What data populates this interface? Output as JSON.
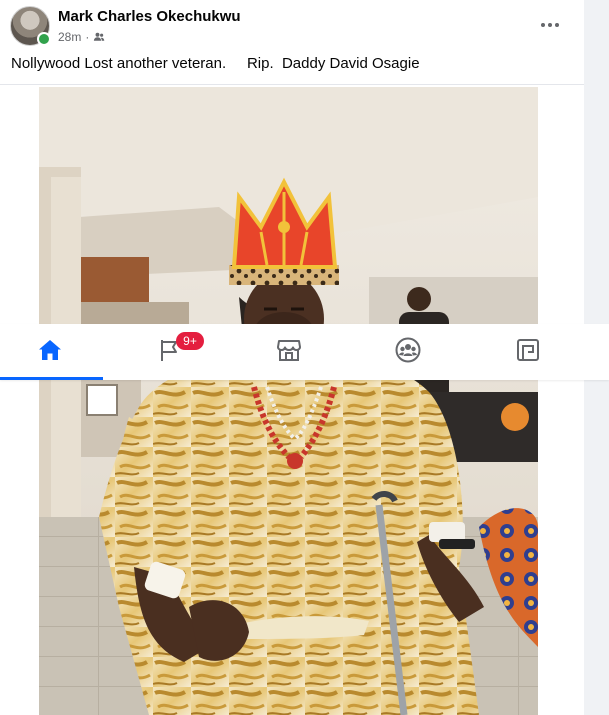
{
  "post": {
    "author": "Mark Charles Okechukwu",
    "time": "28m",
    "separator": "·",
    "audience_icon": "friends-icon",
    "caption": "Nollywood Lost another veteran.     Rip.  Daddy David Osagie",
    "more_icon": "more-horizontal-icon"
  },
  "nav": {
    "items": [
      {
        "name": "home",
        "icon": "home-icon",
        "active": true
      },
      {
        "name": "flag",
        "icon": "flag-icon",
        "active": false
      },
      {
        "name": "marketplace",
        "icon": "marketplace-icon",
        "active": false
      },
      {
        "name": "groups",
        "icon": "groups-icon",
        "active": false
      },
      {
        "name": "gaming",
        "icon": "gaming-icon",
        "active": false
      }
    ],
    "badge": "9+"
  },
  "colors": {
    "accent": "#0866ff",
    "badge": "#e41e3f",
    "online": "#31a24c",
    "icon_gray": "#65676b"
  }
}
